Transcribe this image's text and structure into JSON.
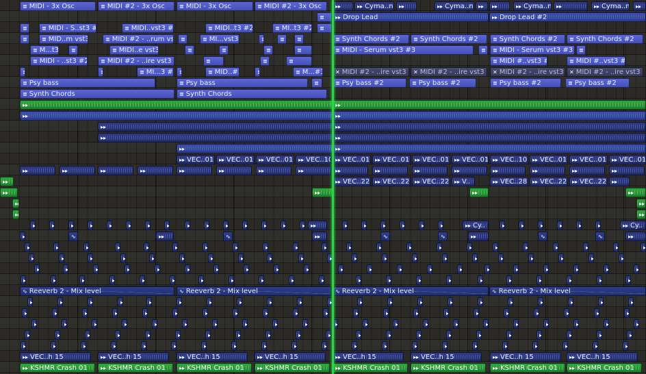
{
  "app": "FL Studio",
  "view": "Playlist - Arrangement",
  "labels": {
    "midi_3x": "MIDI - 3x Osc",
    "midi2_3x": "MIDI #2 - 3x Osc",
    "cyma": "Cyma..n",
    "drop_lead": "Drop Lead",
    "drop_lead2": "Drop Lead #2",
    "midi_s_st3_2": "MIDI - S..st3 #2",
    "midi_vst3_2": "MIDI..vst3 #2",
    "midi_t3_2": "MIDI..t3 #2",
    "mi_t3_2": "MI..t3 #2",
    "synth_chords2": "Synth  Chords #2",
    "synth_chords": "Synth  Chords",
    "midi_m_vst3": "MID..m vst3",
    "midi2_rum": "MIDI #2 - ..rum vst3",
    "mi_vst3": "MI...vst3",
    "midi_serum3": "MIDI - Serum vst3 #3",
    "m_t3": "M...t3",
    "midi_e_vst3": "MIDI..e vst3",
    "midi_st3_2": "MIDI - ..st3 #2",
    "midi2_ire": "MIDI #2 - ..ire vst3 #2",
    "midi_hash": "MIDI #..vst3 #2",
    "midi2_ire4": "MIDI #2 - ..ire vst3 #4",
    "mi_3_3": "MI...3 #3",
    "midi_3": "MID..#3",
    "m_3": "M...#3",
    "psy_bass": "Psy bass",
    "psy_bass2": "Psy bass #2",
    "vec010": "VEC..010",
    "vec10": "VEC..10",
    "vec228": "VEC..228",
    "vec28": "VEC..28",
    "v_short": "V..",
    "cyma_short": "Cy..",
    "reverb": "Reeverb 2 - Mix level",
    "vec15": "VEC..h 15",
    "crash": "KSHMR Crash 01"
  },
  "colors": {
    "bg": "#2b2a26",
    "midi": "#4b56c9",
    "audio": "#3d4fae",
    "green": "#2faa3f",
    "playhead": "#2fd24a"
  },
  "icons": {
    "midi": "piano-roll-icon",
    "audio": "audio-clip-icon",
    "automation": "automation-icon",
    "muted": "muted-x-icon"
  }
}
